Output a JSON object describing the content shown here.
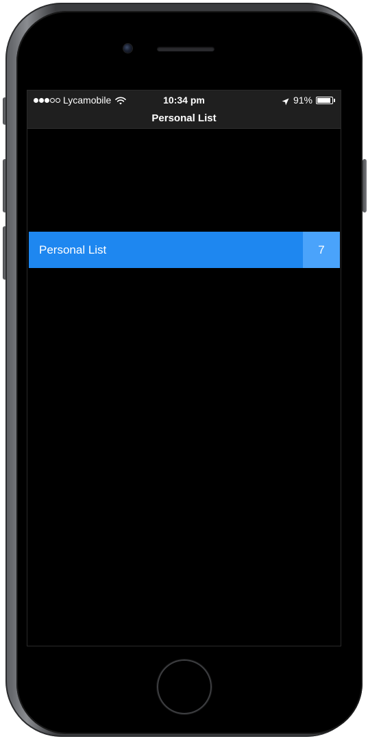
{
  "status_bar": {
    "signal_full": 3,
    "signal_total": 5,
    "carrier": "Lycamobile",
    "time": "10:34 pm",
    "battery_percent": "91%",
    "battery_level": 0.91
  },
  "nav": {
    "title": "Personal List"
  },
  "list": {
    "items": [
      {
        "label": "Personal List",
        "count": "7"
      }
    ]
  },
  "colors": {
    "row_background": "#1e87f0",
    "count_background": "#4aa3fb",
    "bar_background": "#1f1f1f",
    "screen_background": "#000000"
  },
  "icons": [
    "wifi-icon",
    "location-arrow-icon",
    "battery-icon"
  ]
}
